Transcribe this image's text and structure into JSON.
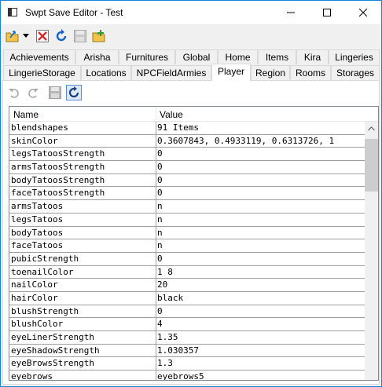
{
  "window": {
    "title": "Swpt Save Editor - Test",
    "controls": {
      "minimize": "minimize",
      "maximize": "maximize",
      "close": "close"
    }
  },
  "toolbar": {
    "icons": [
      "open-folder-icon",
      "dropdown-arrow-icon",
      "close-file-icon",
      "reload-icon",
      "save-disabled-icon",
      "add-folder-icon"
    ]
  },
  "tabs_row1": [
    "Achievements",
    "Arisha",
    "Furnitures",
    "Global",
    "Home",
    "Items",
    "Kira",
    "Lingeries"
  ],
  "tabs_row2": [
    "LingerieStorage",
    "Locations",
    "NPCFieldArmies",
    "Player",
    "Region",
    "Rooms",
    "Storages"
  ],
  "active_tab": "Player",
  "subtoolbar": {
    "icons": [
      "undo-icon",
      "redo-icon",
      "save-icon",
      "refresh-icon"
    ]
  },
  "grid": {
    "columns": [
      "Name",
      "Value"
    ],
    "rows": [
      [
        "blendshapes",
        "91 Items"
      ],
      [
        "skinColor",
        "0.3607843, 0.4933119, 0.6313726, 1"
      ],
      [
        "legsTatoosStrength",
        "0"
      ],
      [
        "armsTatoosStrength",
        "0"
      ],
      [
        "bodyTatoosStrength",
        "0"
      ],
      [
        "faceTatoosStrength",
        "0"
      ],
      [
        "armsTatoos",
        "n"
      ],
      [
        "legsTatoos",
        "n"
      ],
      [
        "bodyTatoos",
        "n"
      ],
      [
        "faceTatoos",
        "n"
      ],
      [
        "pubicStrength",
        "0"
      ],
      [
        "toenailColor",
        "1 8"
      ],
      [
        "nailColor",
        "20"
      ],
      [
        "hairColor",
        "black"
      ],
      [
        "blushStrength",
        "0"
      ],
      [
        "blushColor",
        "4"
      ],
      [
        "eyeLinerStrength",
        "1.35"
      ],
      [
        "eyeShadowStrength",
        "1.030357"
      ],
      [
        "eyeBrowsStrength",
        "1.3"
      ],
      [
        "eyebrows",
        "eyebrows5"
      ]
    ]
  },
  "colors": {
    "accent": "#1883d7",
    "grid_line": "#a0a0a0",
    "tab_bg": "#f0f0f0"
  }
}
